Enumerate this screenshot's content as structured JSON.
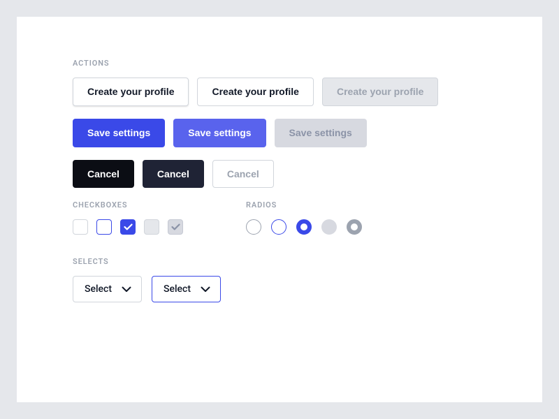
{
  "sections": {
    "actions": "ACTIONS",
    "checkboxes": "CHECKBOXES",
    "radios": "RADIOS",
    "selects": "SELECTS"
  },
  "buttons": {
    "create_profile": "Create your profile",
    "save_settings": "Save settings",
    "cancel": "Cancel"
  },
  "selects": {
    "placeholder": "Select"
  },
  "colors": {
    "primary": "#3a49e8",
    "dark": "#0b0d14",
    "muted": "#9ca3af"
  }
}
